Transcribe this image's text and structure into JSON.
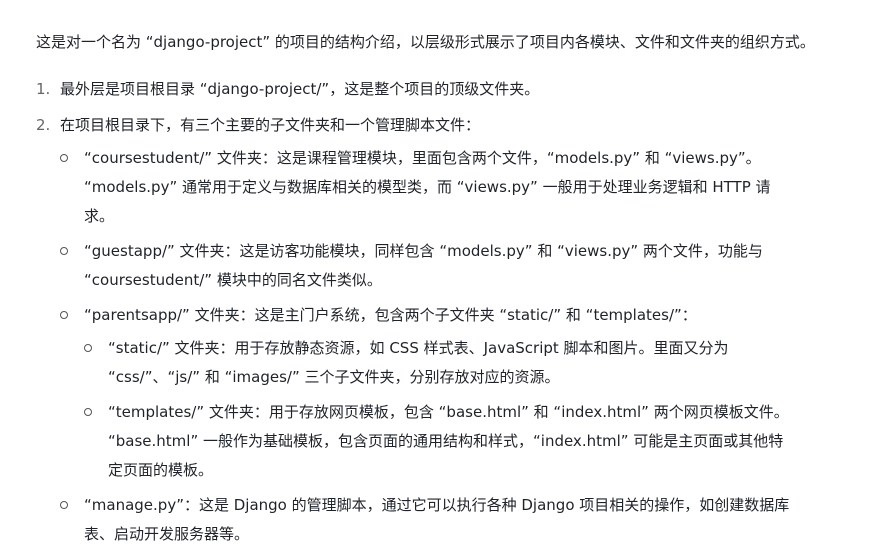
{
  "intro": "这是对一个名为 “django-project” 的项目的结构介绍，以层级形式展示了项目内各模块、文件和文件夹的组织方式。",
  "items": [
    {
      "num": "1.",
      "text": "最外层是项目根目录 “django-project/”，这是整个项目的顶级文件夹。"
    },
    {
      "num": "2.",
      "text": "在项目根目录下，有三个主要的子文件夹和一个管理脚本文件：",
      "sub": [
        {
          "text": "“coursestudent/” 文件夹：这是课程管理模块，里面包含两个文件，“models.py” 和 “views.py”。 “models.py” 通常用于定义与数据库相关的模型类，而 “views.py” 一般用于处理业务逻辑和 HTTP 请求。"
        },
        {
          "text": "“guestapp/” 文件夹：这是访客功能模块，同样包含 “models.py” 和 “views.py” 两个文件，功能与 “coursestudent/” 模块中的同名文件类似。"
        },
        {
          "text": "“parentsapp/” 文件夹：这是主门户系统，包含两个子文件夹 “static/” 和 “templates/”：",
          "sub": [
            {
              "text": "“static/” 文件夹：用于存放静态资源，如 CSS 样式表、JavaScript 脚本和图片。里面又分为 “css/”、“js/” 和 “images/” 三个子文件夹，分别存放对应的资源。"
            },
            {
              "text": "“templates/” 文件夹：用于存放网页模板，包含 “base.html” 和 “index.html” 两个网页模板文件。 “base.html” 一般作为基础模板，包含页面的通用结构和样式，“index.html” 可能是主页面或其他特定页面的模板。"
            }
          ]
        },
        {
          "text": "“manage.py”：这是 Django 的管理脚本，通过它可以执行各种 Django 项目相关的操作，如创建数据库表、启动开发服务器等。"
        }
      ]
    }
  ]
}
